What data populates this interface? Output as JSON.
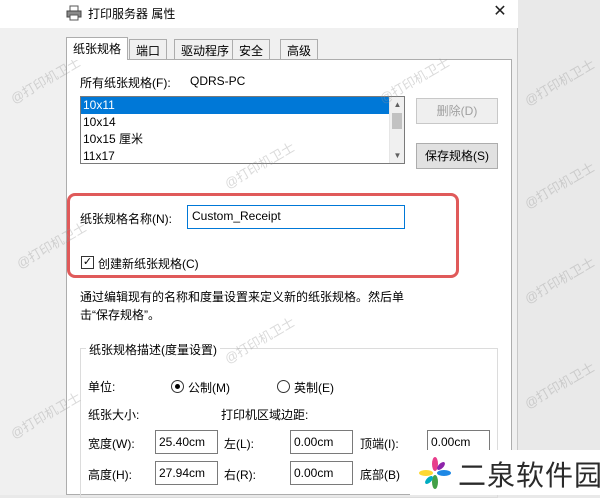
{
  "window": {
    "title": "打印服务器 属性",
    "close_glyph": "✕"
  },
  "tabs": [
    {
      "label": "纸张规格",
      "active": true
    },
    {
      "label": "端口",
      "active": false
    },
    {
      "label": "驱动程序",
      "active": false
    },
    {
      "label": "安全",
      "active": false
    },
    {
      "label": "高级",
      "active": false
    }
  ],
  "forms": {
    "all_forms_label": "所有纸张规格(F):",
    "server_name": "QDRS-PC",
    "items": [
      "10x11",
      "10x14",
      "10x15 厘米",
      "11x17"
    ],
    "selected_item": "10x11",
    "delete_button": "删除(D)",
    "save_button": "保存规格(S)"
  },
  "form_name": {
    "label": "纸张规格名称(N):",
    "value": "Custom_Receipt",
    "create_checkbox_label": "创建新纸张规格(C)",
    "create_checked": true
  },
  "description": {
    "line1": "通过编辑现有的名称和度量设置来定义新的纸张规格。然后单",
    "line2": "击“保存规格”。"
  },
  "group": {
    "title": "纸张规格描述(度量设置)",
    "units_label": "单位:",
    "metric_label": "公制(M)",
    "english_label": "英制(E)",
    "metric_selected": true,
    "paper_size_label": "纸张大小:",
    "margins_label": "打印机区域边距:",
    "width_label": "宽度(W):",
    "width_value": "25.40cm",
    "height_label": "高度(H):",
    "height_value": "27.94cm",
    "left_label": "左(L):",
    "left_value": "0.00cm",
    "right_label": "右(R):",
    "right_value": "0.00cm",
    "top_label": "顶端(I):",
    "top_value": "0.00cm",
    "bottom_label": "底部(B)"
  },
  "watermark": {
    "text": "@打印机卫士"
  },
  "brand": {
    "logo_text": "二泉软件园",
    "colors": [
      "#e83e8c",
      "#1e88e5",
      "#43a047",
      "#fdd835"
    ]
  },
  "accent_colors": {
    "selection": "#0078d7",
    "highlight_border": "#e05a5a"
  }
}
